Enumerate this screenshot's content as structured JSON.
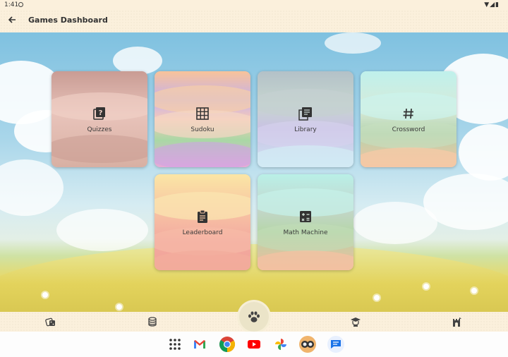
{
  "status": {
    "time": "1:41",
    "icons": "▼◢▮"
  },
  "app_bar": {
    "back_icon": "arrow-left-icon",
    "title": "Games Dashboard"
  },
  "tiles": [
    {
      "label": "Quizzes",
      "icon": "quiz-icon"
    },
    {
      "label": "Sudoku",
      "icon": "grid-icon"
    },
    {
      "label": "Library",
      "icon": "library-icon"
    },
    {
      "label": "Crossword",
      "icon": "hash-icon"
    },
    {
      "label": "Leaderboard",
      "icon": "clipboard-icon"
    },
    {
      "label": "Math Machine",
      "icon": "calculator-icon"
    }
  ],
  "bottom_nav": {
    "items": [
      "dice-icon",
      "coins-icon",
      "paw-icon",
      "graduate-icon",
      "castle-icon"
    ]
  },
  "taskbar": {
    "apps": [
      "app-grid-icon",
      "gmail-icon",
      "chrome-icon",
      "youtube-icon",
      "photos-icon",
      "avatar-app-icon",
      "messages-icon"
    ]
  }
}
